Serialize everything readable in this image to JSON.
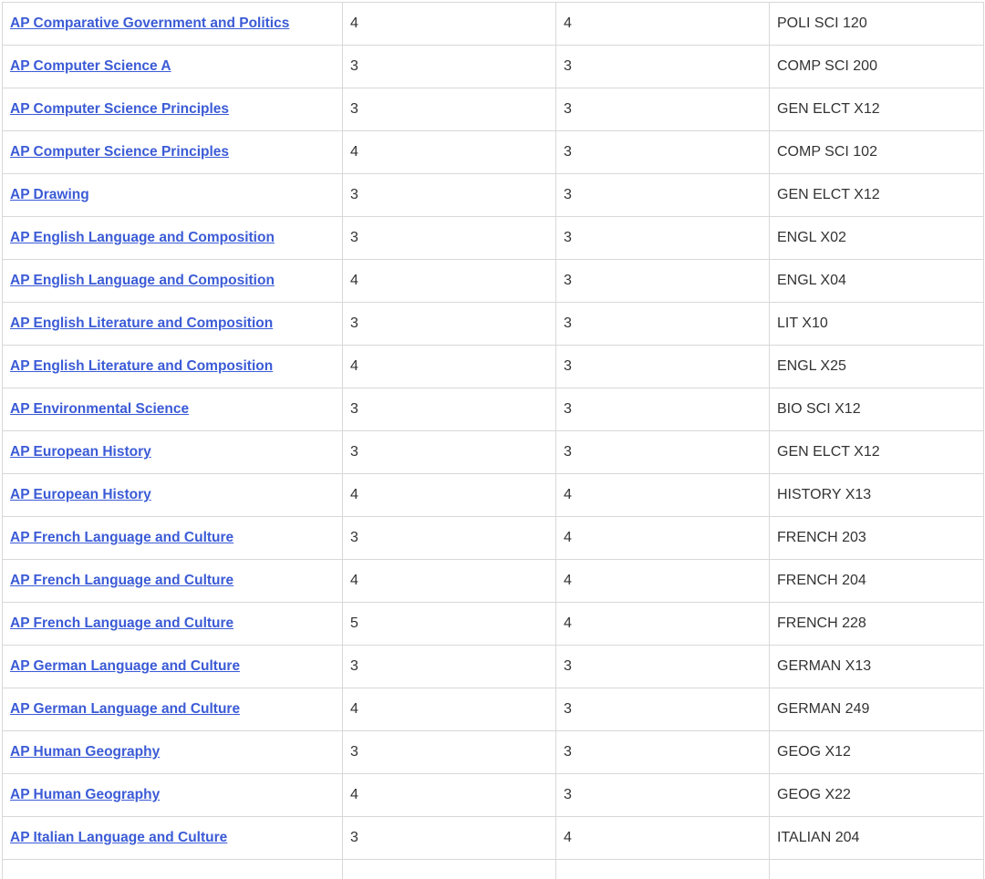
{
  "rows": [
    {
      "exam": "AP Comparative Government and Politics",
      "score": "4",
      "units": "4",
      "course": "POLI SCI 120"
    },
    {
      "exam": "AP Computer Science A",
      "score": "3",
      "units": "3",
      "course": "COMP SCI 200"
    },
    {
      "exam": "AP Computer Science Principles",
      "score": "3",
      "units": "3",
      "course": "GEN ELCT X12"
    },
    {
      "exam": "AP Computer Science Principles",
      "score": "4",
      "units": "3",
      "course": "COMP SCI 102"
    },
    {
      "exam": "AP Drawing",
      "score": "3",
      "units": "3",
      "course": "GEN ELCT X12"
    },
    {
      "exam": "AP English Language and Composition",
      "score": "3",
      "units": "3",
      "course": "ENGL X02"
    },
    {
      "exam": "AP English Language and Composition",
      "score": "4",
      "units": "3",
      "course": "ENGL X04"
    },
    {
      "exam": "AP English Literature and Composition",
      "score": "3",
      "units": "3",
      "course": "LIT X10"
    },
    {
      "exam": "AP English Literature and Composition",
      "score": "4",
      "units": "3",
      "course": "ENGL X25"
    },
    {
      "exam": "AP Environmental Science",
      "score": "3",
      "units": "3",
      "course": "BIO SCI X12"
    },
    {
      "exam": "AP European History",
      "score": "3",
      "units": "3",
      "course": "GEN ELCT X12"
    },
    {
      "exam": "AP European History",
      "score": "4",
      "units": "4",
      "course": "HISTORY X13"
    },
    {
      "exam": "AP French Language and Culture",
      "score": "3",
      "units": "4",
      "course": "FRENCH 203"
    },
    {
      "exam": "AP French Language and Culture",
      "score": "4",
      "units": "4",
      "course": "FRENCH 204"
    },
    {
      "exam": "AP French Language and Culture",
      "score": "5",
      "units": "4",
      "course": "FRENCH 228"
    },
    {
      "exam": "AP German Language and Culture",
      "score": "3",
      "units": "3",
      "course": "GERMAN X13"
    },
    {
      "exam": "AP German Language and Culture",
      "score": "4",
      "units": "3",
      "course": "GERMAN 249"
    },
    {
      "exam": "AP Human Geography",
      "score": "3",
      "units": "3",
      "course": "GEOG X12"
    },
    {
      "exam": "AP Human Geography",
      "score": "4",
      "units": "3",
      "course": "GEOG X22"
    },
    {
      "exam": "AP Italian Language and Culture",
      "score": "3",
      "units": "4",
      "course": "ITALIAN 204"
    },
    {
      "exam": "",
      "score": "",
      "units": "",
      "course": ""
    }
  ]
}
